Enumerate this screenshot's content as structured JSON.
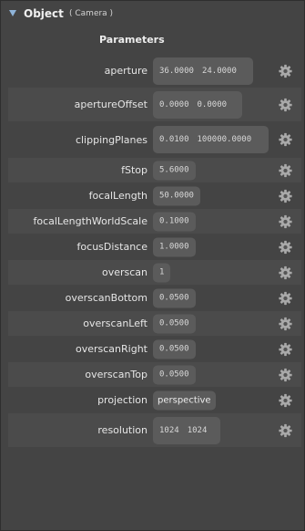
{
  "header": {
    "title": "Object",
    "subtitle": "( Camera )"
  },
  "section_label": "Parameters",
  "rows": [
    {
      "label": "aperture",
      "values": [
        "36.0000",
        "24.0000"
      ]
    },
    {
      "label": "apertureOffset",
      "values": [
        "0.0000",
        "0.0000"
      ]
    },
    {
      "label": "clippingPlanes",
      "values": [
        "0.0100",
        "100000.0000"
      ]
    },
    {
      "label": "fStop",
      "values": [
        "5.6000"
      ]
    },
    {
      "label": "focalLength",
      "values": [
        "50.0000"
      ]
    },
    {
      "label": "focalLengthWorldScale",
      "values": [
        "0.1000"
      ]
    },
    {
      "label": "focusDistance",
      "values": [
        "1.0000"
      ]
    },
    {
      "label": "overscan",
      "values": [
        "1"
      ]
    },
    {
      "label": "overscanBottom",
      "values": [
        "0.0500"
      ]
    },
    {
      "label": "overscanLeft",
      "values": [
        "0.0500"
      ]
    },
    {
      "label": "overscanRight",
      "values": [
        "0.0500"
      ]
    },
    {
      "label": "overscanTop",
      "values": [
        "0.0500"
      ]
    },
    {
      "label": "projection",
      "values": [
        "perspective"
      ]
    },
    {
      "label": "resolution",
      "values": [
        "1024",
        "1024"
      ]
    }
  ],
  "icons": {
    "collapse": "triangle-down-icon",
    "settings": "gear-icon"
  }
}
